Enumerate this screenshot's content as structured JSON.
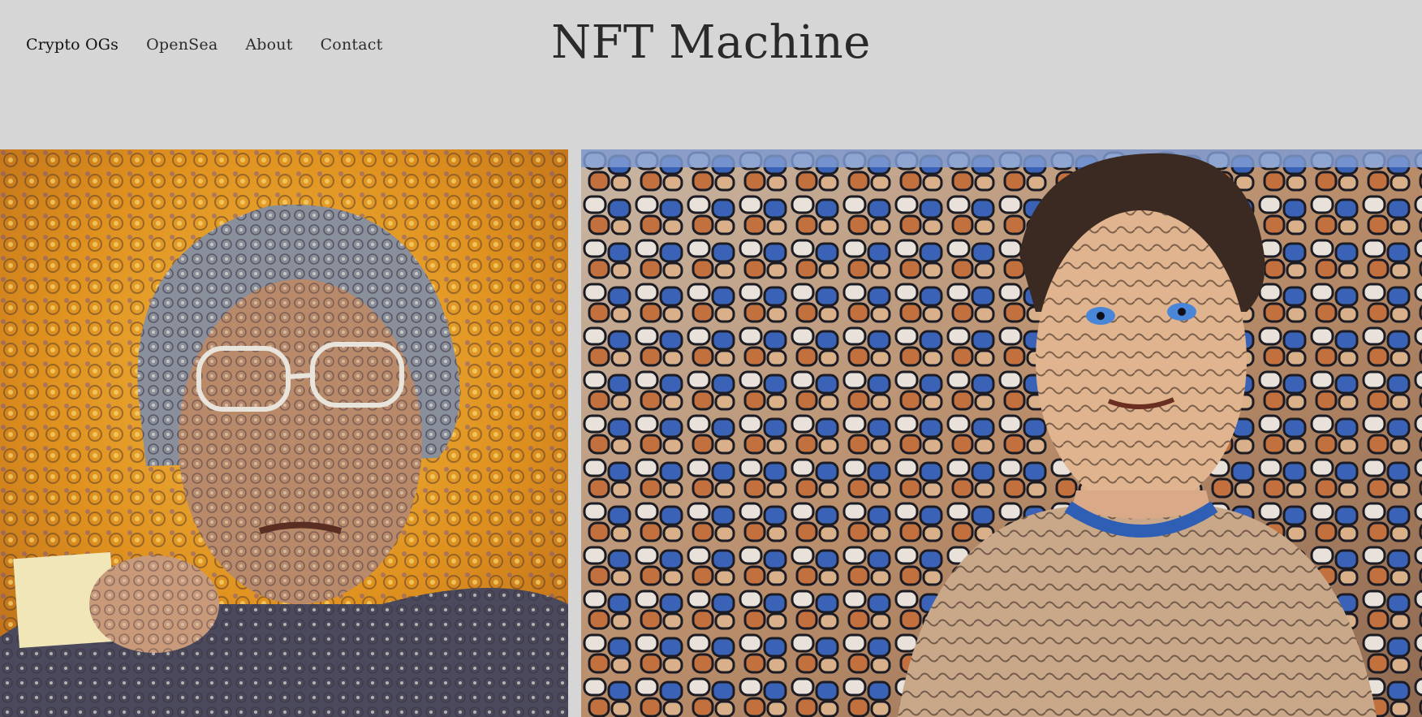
{
  "site": {
    "title": "NFT Machine"
  },
  "nav": {
    "items": [
      {
        "label": "Crypto OGs"
      },
      {
        "label": "OpenSea"
      },
      {
        "label": "About"
      },
      {
        "label": "Contact"
      }
    ]
  },
  "gallery": {
    "items": [
      {
        "subject": "stylized portrait of older man with glasses holding a card",
        "palette": [
          "#e59a22",
          "#f2c53a",
          "#5a4c7a",
          "#d9d0c0",
          "#2b2b3a"
        ]
      },
      {
        "subject": "stylized portrait of young man with blue eyes",
        "palette": [
          "#3a63b8",
          "#d9b08a",
          "#c2703e",
          "#ece3d8",
          "#1c1c24"
        ]
      }
    ]
  },
  "colors": {
    "background": "#d6d6d6",
    "title_text": "#2a2a2a",
    "nav_text": "#2c2c2c"
  }
}
